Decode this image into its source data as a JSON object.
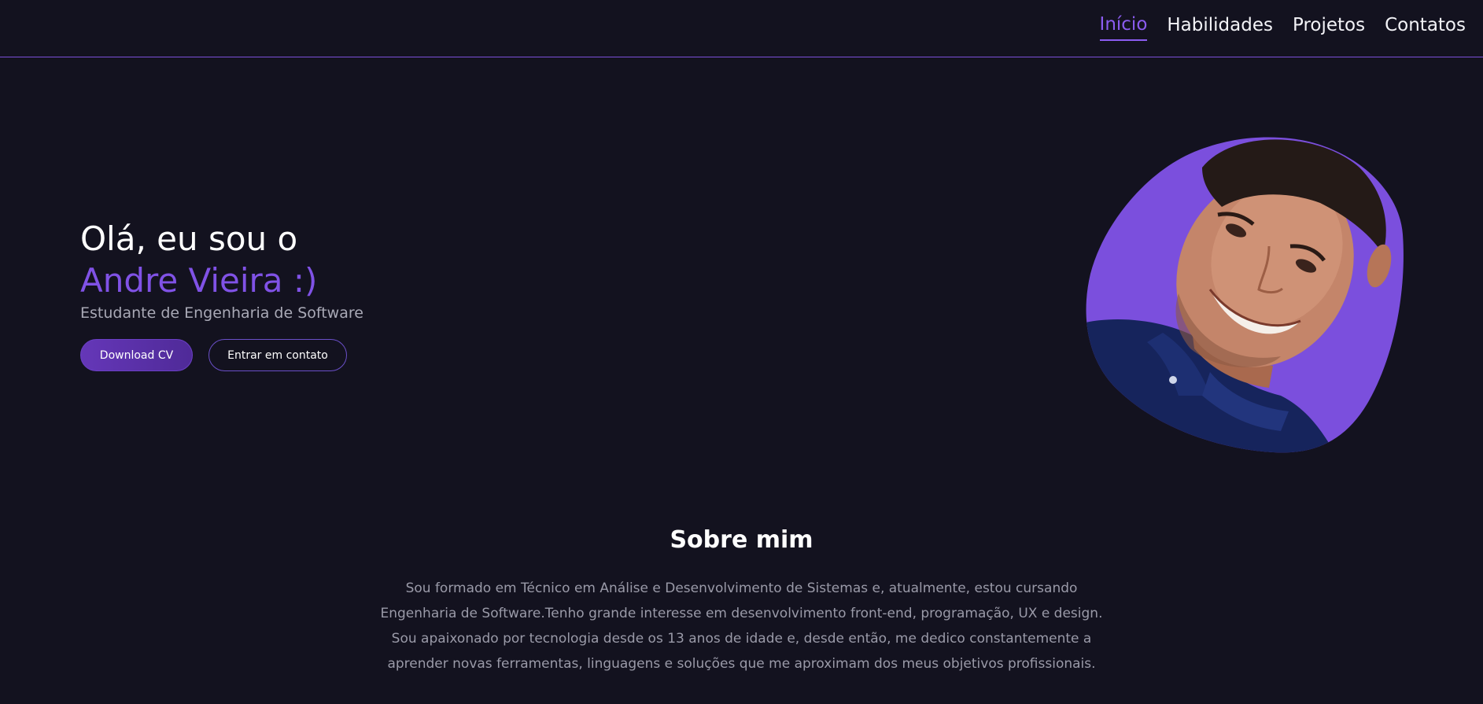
{
  "nav": {
    "items": [
      {
        "label": "Início",
        "active": true
      },
      {
        "label": "Habilidades",
        "active": false
      },
      {
        "label": "Projetos",
        "active": false
      },
      {
        "label": "Contatos",
        "active": false
      }
    ]
  },
  "hero": {
    "greeting": "Olá, eu sou o",
    "name": "Andre Vieira :)",
    "subtitle": "Estudante de Engenharia de Software",
    "primary_button": "Download CV",
    "secondary_button": "Entrar em contato"
  },
  "about": {
    "title": "Sobre mim",
    "text": "Sou formado em Técnico em Análise e Desenvolvimento de Sistemas e, atualmente, estou cursando Engenharia de Software.Tenho grande interesse em desenvolvimento front-end, programação, UX e design. Sou apaixonado por tecnologia desde os 13 anos de idade e, desde então, me dedico constantemente a aprender novas ferramentas, linguagens e soluções que me aproximam dos meus objetivos profissionais."
  },
  "colors": {
    "background": "#13121f",
    "accent": "#8052e6",
    "photo_background": "#7b4fdd",
    "shirt": "#16245c"
  }
}
